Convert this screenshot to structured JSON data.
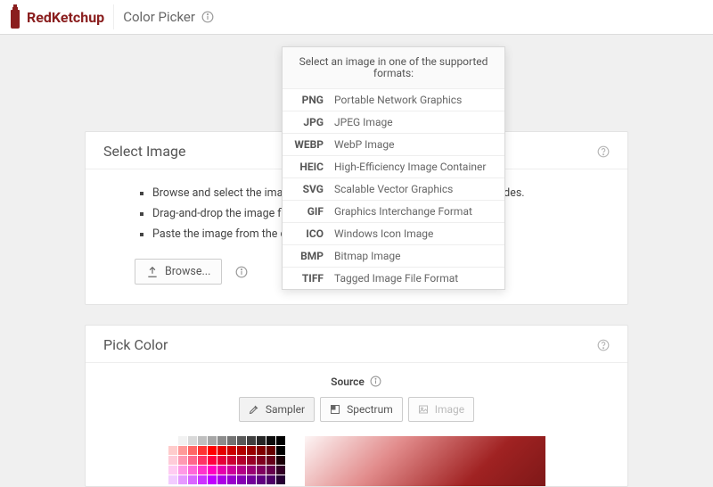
{
  "brand": "RedKetchup",
  "page_title": "Color Picker",
  "tooltip": {
    "heading": "Select an image in one of the supported formats:",
    "formats": [
      {
        "abbr": "PNG",
        "name": "Portable Network Graphics"
      },
      {
        "abbr": "JPG",
        "name": "JPEG Image"
      },
      {
        "abbr": "WEBP",
        "name": "WebP Image"
      },
      {
        "abbr": "HEIC",
        "name": "High-Efficiency Image Container"
      },
      {
        "abbr": "SVG",
        "name": "Scalable Vector Graphics"
      },
      {
        "abbr": "GIF",
        "name": "Graphics Interchange Format"
      },
      {
        "abbr": "ICO",
        "name": "Windows Icon Image"
      },
      {
        "abbr": "BMP",
        "name": "Bitmap Image"
      },
      {
        "abbr": "TIFF",
        "name": "Tagged Image File Format"
      }
    ]
  },
  "select_card": {
    "title": "Select Image",
    "bullets": [
      "Browse and select the image from which you want to pick the colors codes.",
      "Drag-and-drop the image file.",
      "Paste the image from the clipboard (Ctrl-V or ⌘V)."
    ],
    "browse_label": "Browse..."
  },
  "pick_card": {
    "title": "Pick Color",
    "source_label": "Source",
    "tabs": {
      "sampler": "Sampler",
      "spectrum": "Spectrum",
      "image": "Image"
    }
  },
  "swatch_rows": [
    [
      "#ffffff",
      "#f2f2f2",
      "#d9d9d9",
      "#bfbfbf",
      "#a6a6a6",
      "#8c8c8c",
      "#737373",
      "#595959",
      "#404040",
      "#262626",
      "#0d0d0d",
      "#000000"
    ],
    [
      "#ffcccc",
      "#ff9999",
      "#ff6666",
      "#ff3333",
      "#ff0000",
      "#e60000",
      "#cc0000",
      "#b30000",
      "#990000",
      "#800000",
      "#660000",
      "#000000"
    ],
    [
      "#ffccd9",
      "#ff99b3",
      "#ff668c",
      "#ff3366",
      "#ff0040",
      "#e60039",
      "#cc0033",
      "#b3002d",
      "#990026",
      "#800020",
      "#66001a",
      "#1a0007"
    ],
    [
      "#ffccf2",
      "#ff99e6",
      "#ff66d9",
      "#ff33cc",
      "#ff00bf",
      "#e600ac",
      "#cc0099",
      "#b30086",
      "#990073",
      "#800060",
      "#66004d",
      "#330026"
    ],
    [
      "#f2ccff",
      "#e699ff",
      "#d966ff",
      "#cc33ff",
      "#bf00ff",
      "#ac00e6",
      "#9900cc",
      "#8600b3",
      "#730099",
      "#600080",
      "#4d0066",
      "#260033"
    ]
  ]
}
